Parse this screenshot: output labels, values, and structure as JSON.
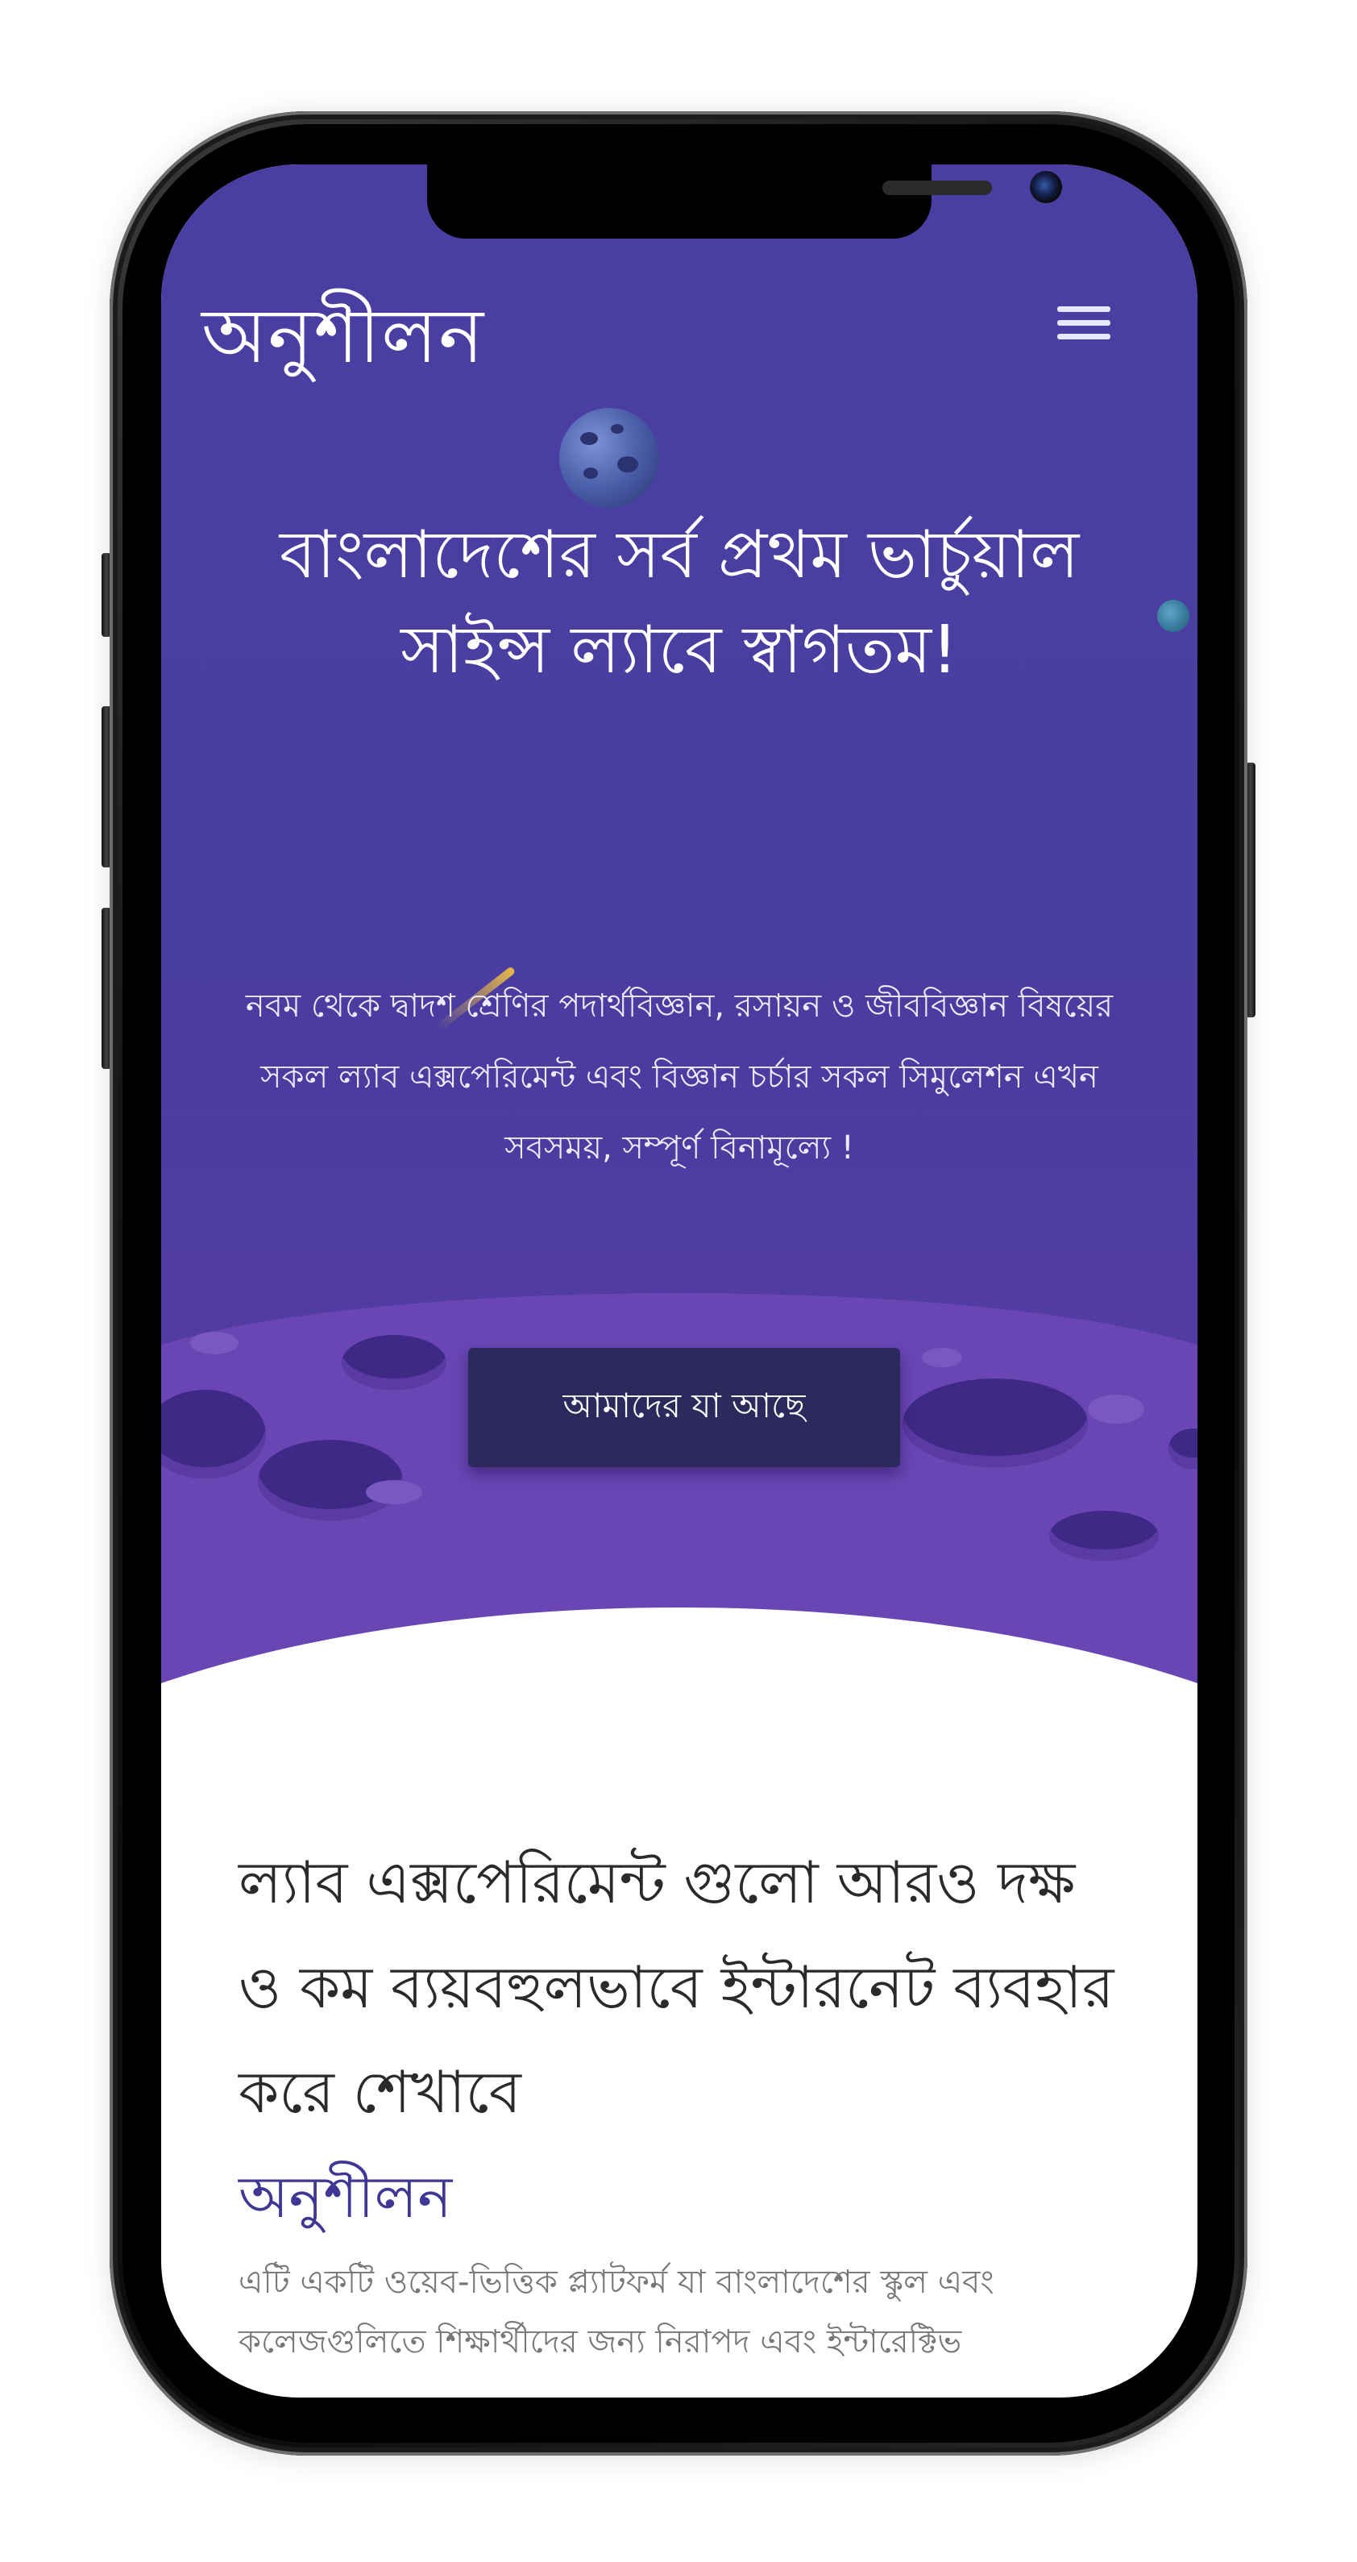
{
  "header": {
    "brand": "অনুশীলন",
    "menu_icon": "hamburger-menu-icon"
  },
  "hero": {
    "title": "বাংলাদেশের সর্ব প্রথম ভার্চুয়াল সাইন্স ল্যাবে স্বাগতম!",
    "subtitle": "নবম থেকে দ্বাদশ শ্রেণির পদার্থবিজ্ঞান, রসায়ন ও জীববিজ্ঞান বিষয়ের সকল ল্যাব এক্সপেরিমেন্ট এবং বিজ্ঞান চর্চার সকল সিমুলেশন এখন সবসময়, সম্পূর্ণ বিনামূল্যে !",
    "cta_label": "আমাদের যা আছে"
  },
  "content": {
    "heading": "ল্যাব এক্সপেরিমেন্ট গুলো আরও দক্ষ ও কম ব্যয়বহুলভাবে ইন্টারনেট ব্যবহার করে শেখাবে",
    "heading_accent": "অনুশীলন",
    "paragraph": "এটি একটি ওয়েব-ভিত্তিক প্ল্যাটফর্ম যা বাংলাদেশের স্কুল এবং কলেজগুলিতে শিক্ষার্থীদের জন্য নিরাপদ এবং ইন্টারেক্টিভ"
  },
  "colors": {
    "hero_bg": "#4b3ea3",
    "cta_bg": "#2c2a5c",
    "accent": "#3f3793"
  }
}
